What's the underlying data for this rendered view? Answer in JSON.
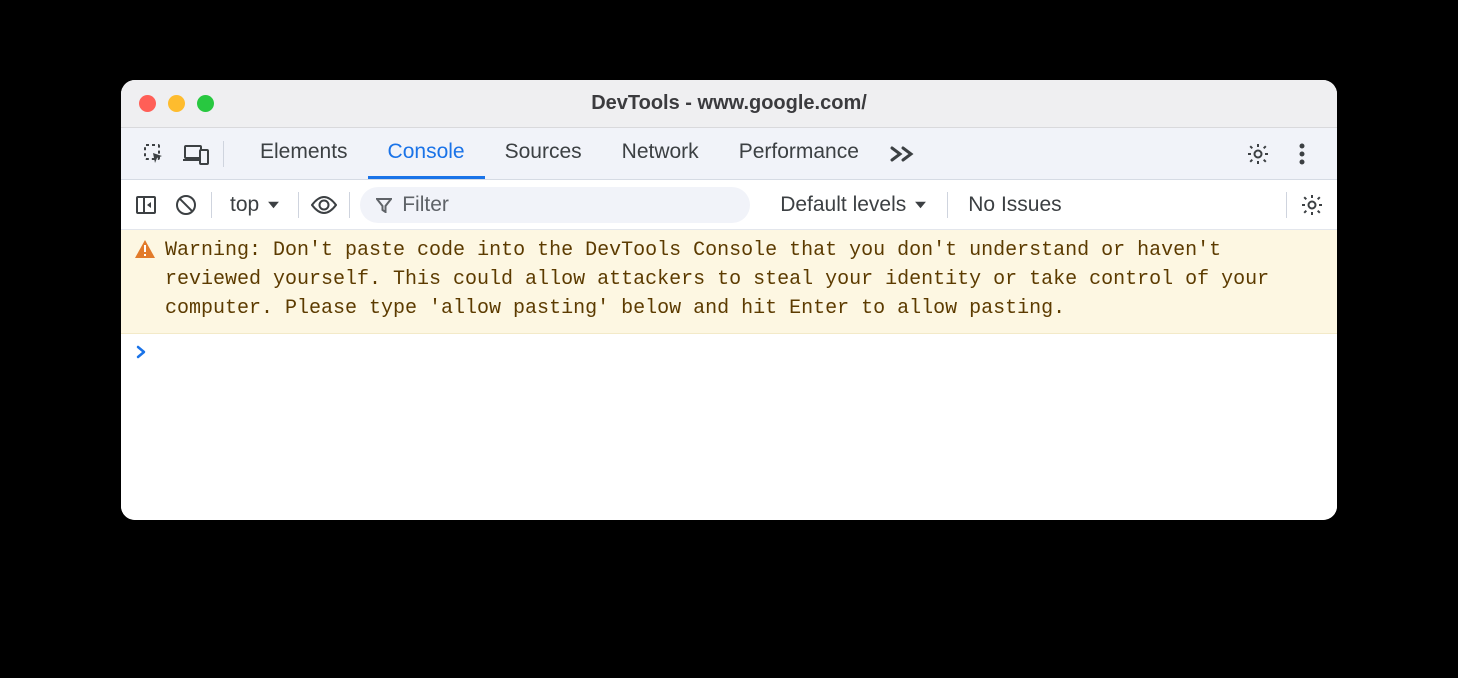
{
  "window": {
    "title": "DevTools - www.google.com/"
  },
  "tabs": {
    "items": [
      "Elements",
      "Console",
      "Sources",
      "Network",
      "Performance"
    ],
    "active_index": 1
  },
  "subbar": {
    "context": "top",
    "filter_placeholder": "Filter",
    "levels": "Default levels",
    "issues": "No Issues"
  },
  "console": {
    "warning_label": "Warning:",
    "warning_body": "Don't paste code into the DevTools Console that you don't understand or haven't reviewed yourself. This could allow attackers to steal your identity or take control of your computer. Please type 'allow pasting' below and hit Enter to allow pasting."
  }
}
